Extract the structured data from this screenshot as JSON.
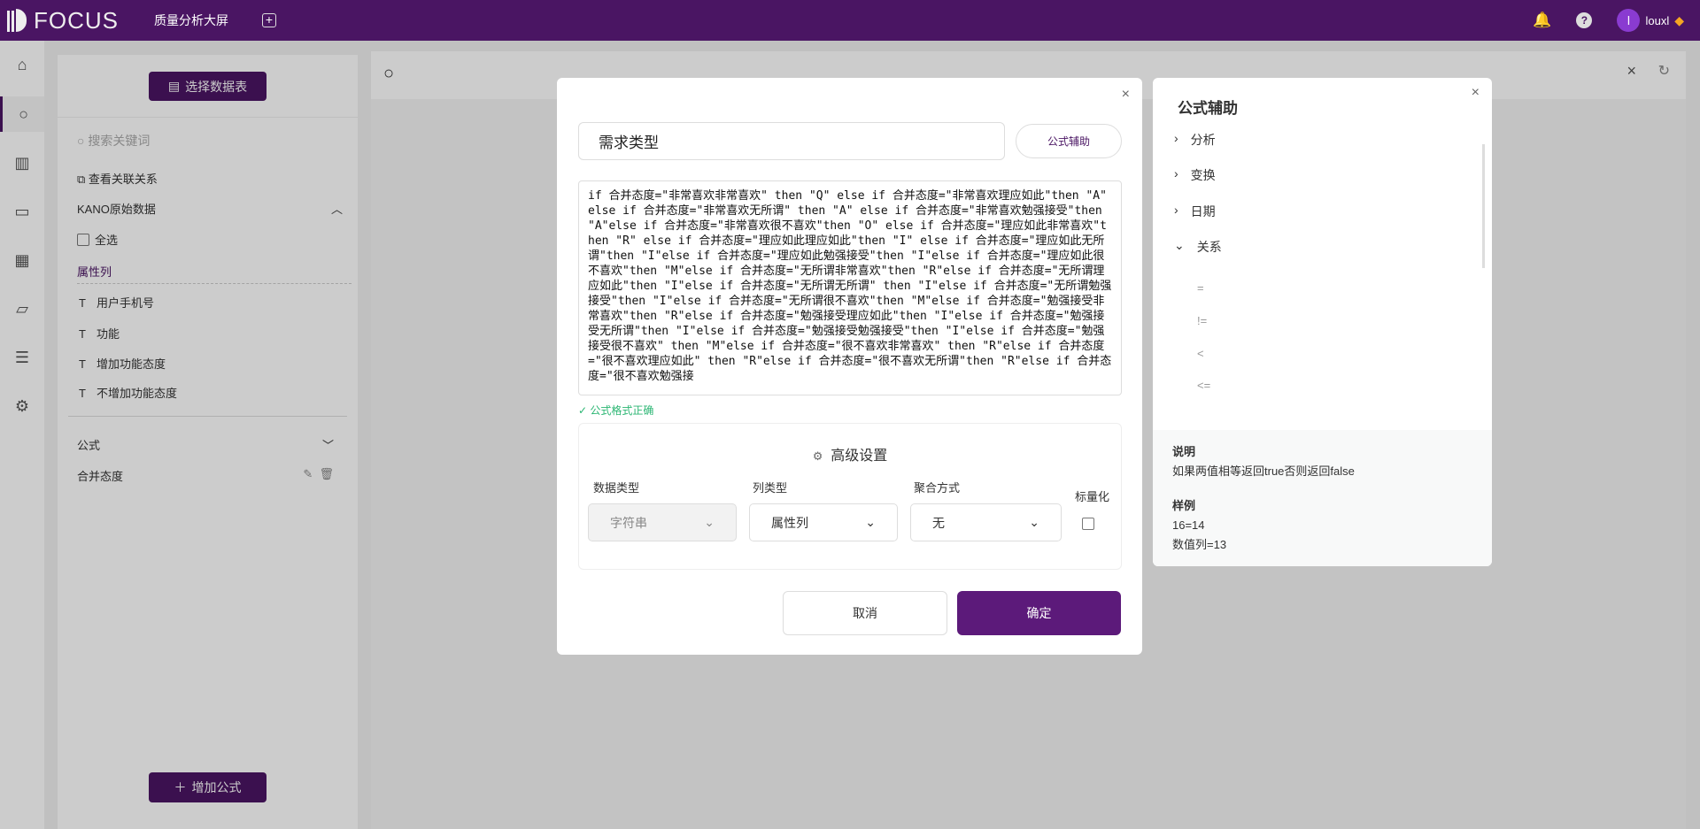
{
  "topbar": {
    "logo": "FOCUS",
    "title": "质量分析大屏",
    "user": "louxl"
  },
  "rail": [
    "home-icon",
    "search-icon",
    "chart-icon",
    "presentation-icon",
    "table-icon",
    "folder-icon",
    "database-icon",
    "gear-icon"
  ],
  "left": {
    "select_table": "选择数据表",
    "search_placeholder": "搜索关键词",
    "relations": "查看关联关系",
    "table_name": "KANO原始数据",
    "select_all": "全选",
    "attr_header": "属性列",
    "columns": [
      "用户手机号",
      "功能",
      "增加功能态度",
      "不增加功能态度"
    ],
    "formula_header": "公式",
    "formulas": [
      "合并态度"
    ],
    "add_formula": "增加公式"
  },
  "modal": {
    "name": "需求类型",
    "formula_help": "公式辅助",
    "formula": "if 合并态度=\"非常喜欢非常喜欢\" then \"Q\" else if 合并态度=\"非常喜欢理应如此\"then \"A\" else if 合并态度=\"非常喜欢无所谓\" then \"A\" else if 合并态度=\"非常喜欢勉强接受\"then \"A\"else if 合并态度=\"非常喜欢很不喜欢\"then \"O\" else if 合并态度=\"理应如此非常喜欢\"then \"R\" else if 合并态度=\"理应如此理应如此\"then \"I\" else if 合并态度=\"理应如此无所谓\"then \"I\"else if 合并态度=\"理应如此勉强接受\"then \"I\"else if 合并态度=\"理应如此很不喜欢\"then \"M\"else if 合并态度=\"无所谓非常喜欢\"then \"R\"else if 合并态度=\"无所谓理应如此\"then \"I\"else if 合并态度=\"无所谓无所谓\" then \"I\"else if 合并态度=\"无所谓勉强接受\"then \"I\"else if 合并态度=\"无所谓很不喜欢\"then \"M\"else if 合并态度=\"勉强接受非常喜欢\"then \"R\"else if 合并态度=\"勉强接受理应如此\"then \"I\"else if 合并态度=\"勉强接受无所谓\"then \"I\"else if 合并态度=\"勉强接受勉强接受\"then \"I\"else if 合并态度=\"勉强接受很不喜欢\" then \"M\"else if 合并态度=\"很不喜欢非常喜欢\" then \"R\"else if 合并态度=\"很不喜欢理应如此\" then \"R\"else if 合并态度=\"很不喜欢无所谓\"then \"R\"else if 合并态度=\"很不喜欢勉强接",
    "valid": "公式格式正确",
    "advanced": "高级设置",
    "data_type_label": "数据类型",
    "data_type": "字符串",
    "col_type_label": "列类型",
    "col_type": "属性列",
    "agg_label": "聚合方式",
    "agg": "无",
    "scale_label": "标量化",
    "cancel": "取消",
    "confirm": "确定"
  },
  "helper": {
    "title": "公式辅助",
    "categories": [
      {
        "label": "分析",
        "expanded": false
      },
      {
        "label": "变换",
        "expanded": false
      },
      {
        "label": "日期",
        "expanded": false
      },
      {
        "label": "关系",
        "expanded": true
      }
    ],
    "operators": [
      "=",
      "!=",
      "<",
      "<="
    ],
    "desc_title": "说明",
    "desc": "如果两值相等返回true否则返回false",
    "example_title": "样例",
    "examples": [
      "16=14",
      "数值列=13"
    ]
  },
  "colors": {
    "brand": "#4a1563",
    "valid": "#2bb673"
  }
}
